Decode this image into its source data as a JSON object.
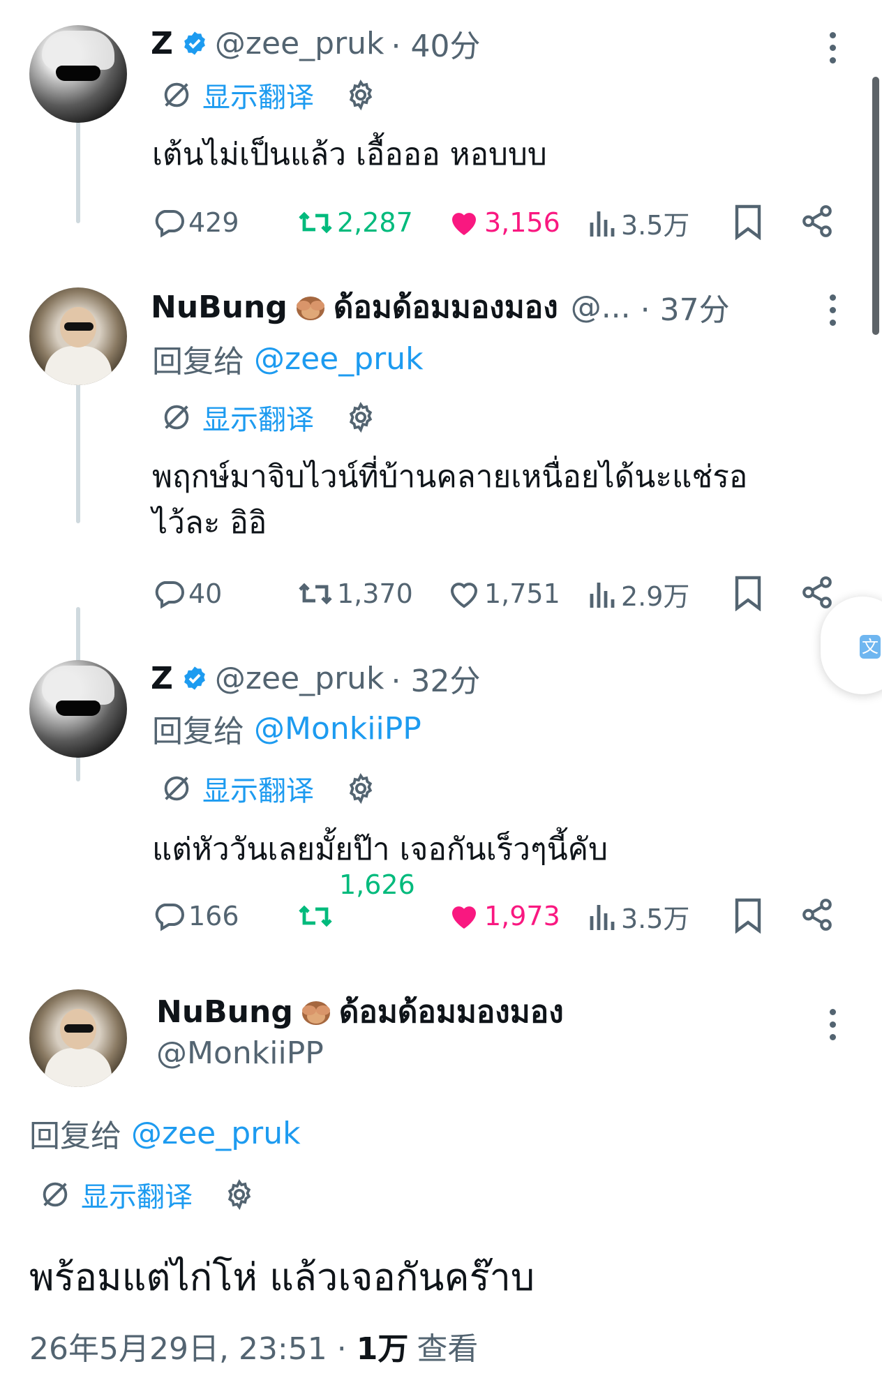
{
  "translate_label": "显示翻译",
  "reply_prefix": "回复给",
  "tweets": [
    {
      "name": "Z",
      "handle": "@zee_pruk",
      "time": "· 40分",
      "text": "เต้นไม่เป็นแล้ว เอื้อออ หอบบบ",
      "stats": {
        "replies": "429",
        "retweets": "2,287",
        "likes": "3,156",
        "views": "3.5万"
      }
    },
    {
      "name": "NuBung",
      "name_suffix": "ด้อมด้อมมองมอง",
      "handle": "@...",
      "time": "· 37分",
      "reply_to": "@zee_pruk",
      "text_line1": "พฤกษ์มาจิบไวน์ที่บ้านคลายเหนื่อยได้นะแช่รอ",
      "text_line2": "ไว้ละ อิอิ",
      "stats": {
        "replies": "40",
        "retweets": "1,370",
        "likes": "1,751",
        "views": "2.9万"
      }
    },
    {
      "name": "Z",
      "handle": "@zee_pruk",
      "time": "· 32分",
      "reply_to": "@MonkiiPP",
      "text": "แต่หัววันเลยมั้ยป๊า เจอกันเร็วๆนี้คับ",
      "stats": {
        "replies": "166",
        "retweets": "1,626",
        "likes": "1,973",
        "views": "3.5万"
      }
    },
    {
      "name": "NuBung",
      "name_suffix": "ด้อมด้อมมองมอง",
      "handle": "@MonkiiPP",
      "reply_to": "@zee_pruk",
      "text": "พร้อมแต่ไก่โห่ แล้วเจอกันคร๊าบ",
      "timestamp": "26年5月29日, 23:51 ·",
      "views_count": "1万",
      "views_label": "查看"
    }
  ],
  "colors": {
    "accent": "#1d9bf0",
    "retweet": "#00ba7c",
    "like": "#f91880",
    "muted": "#536471"
  }
}
